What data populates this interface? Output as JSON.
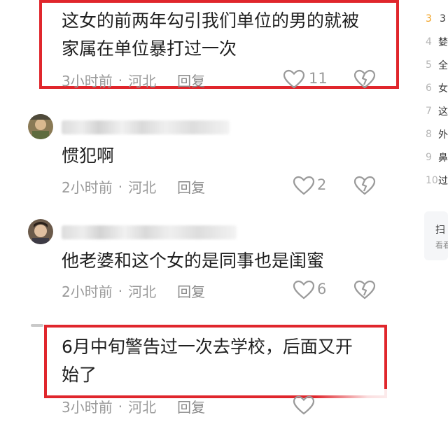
{
  "comments": [
    {
      "text_lines": [
        "这女的前两年勾引我们单位的男的就被",
        "家属在单位暴打过一次"
      ],
      "time": "3小时前",
      "location": "河北",
      "reply_label": "回复",
      "likes": "11"
    },
    {
      "text_lines": [
        "惯犯啊"
      ],
      "time": "2小时前",
      "location": "河北",
      "reply_label": "回复",
      "likes": "2"
    },
    {
      "text_lines": [
        "他老婆和这个女的是同事也是闺蜜"
      ],
      "time": "2小时前",
      "location": "河北",
      "reply_label": "回复",
      "likes": "6"
    },
    {
      "text_lines": [
        "6月中旬警告过一次去学校，后面又开",
        "始了"
      ],
      "time": "3小时前",
      "location": "河北",
      "reply_label": "回复",
      "likes": ""
    }
  ],
  "separator": "·",
  "sidebar": {
    "ranks": [
      {
        "num": "3",
        "text": "3"
      },
      {
        "num": "4",
        "text": "婪"
      },
      {
        "num": "5",
        "text": "全"
      },
      {
        "num": "6",
        "text": "女"
      },
      {
        "num": "7",
        "text": "这"
      },
      {
        "num": "8",
        "text": "外"
      },
      {
        "num": "9",
        "text": "鼻"
      },
      {
        "num": "10",
        "text": "过"
      }
    ],
    "card": {
      "line1": "扫",
      "line2": "看看"
    }
  },
  "colors": {
    "highlight_border": "#e0262c",
    "meta_gray": "#9a9a9a",
    "rank_top": "#f0a020"
  }
}
